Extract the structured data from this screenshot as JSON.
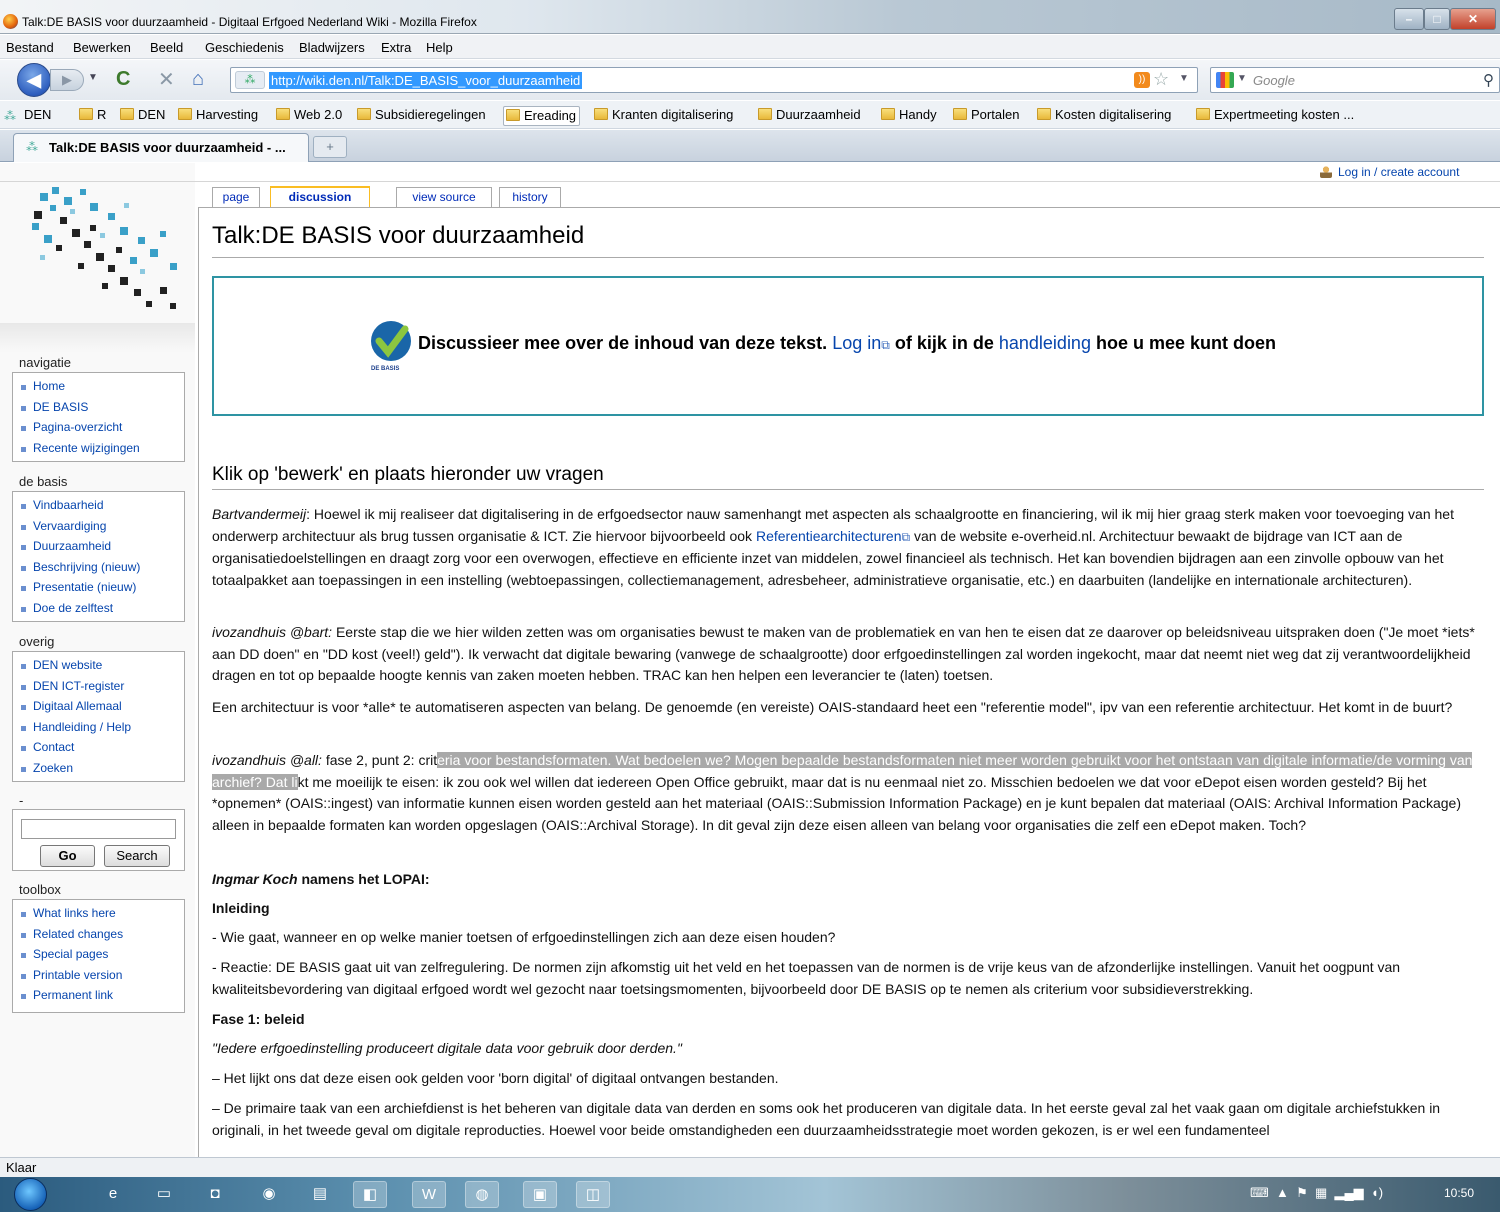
{
  "window": {
    "title": "Talk:DE BASIS voor duurzaamheid - Digitaal Erfgoed Nederland Wiki - Mozilla Firefox"
  },
  "menu": [
    "Bestand",
    "Bewerken",
    "Beeld",
    "Geschiedenis",
    "Bladwijzers",
    "Extra",
    "Help"
  ],
  "nav": {
    "url": "http://wiki.den.nl/Talk:DE_BASIS_voor_duurzaamheid",
    "search_placeholder": "Google"
  },
  "bookmarks": [
    "DEN",
    "R",
    "DEN",
    "Harvesting",
    "Web 2.0",
    "Subsidieregelingen",
    "Ereading",
    "Kranten digitalisering",
    "Duurzaamheid",
    "Handy",
    "Portalen",
    "Kosten digitalisering",
    "Expertmeeting kosten ..."
  ],
  "tab": {
    "label": "Talk:DE BASIS voor duurzaamheid - ...",
    "new_tab": "+"
  },
  "page": {
    "login": "Log in / create account",
    "tabs": [
      "page",
      "discussion",
      "view source",
      "history"
    ],
    "title": "Talk:DE BASIS voor duurzaamheid",
    "notice": {
      "text1": "Discussieer mee over de inhoud van deze tekst.",
      "link1": "Log in",
      "text2": "of kijk in de",
      "link2": "handleiding",
      "text3": "hoe u mee kunt doen",
      "logo_label": "DE BASIS"
    },
    "heading": "Klik op 'bewerk' en plaats hieronder uw vragen",
    "p1": {
      "author": "Bartvandermeij",
      "a": ": Hoewel ik mij realiseer dat digitalisering in de erfgoedsector nauw samenhangt met aspecten als schaalgrootte en financiering, wil ik mij hier graag sterk maken voor toevoeging van het onderwerp architectuur als brug tussen organisatie & ICT. Zie hiervoor bijvoorbeeld ook ",
      "link": "Referentiearchitecturen",
      "b": " van de website e-overheid.nl. Architectuur bewaakt de bijdrage van ICT aan de organisatiedoelstellingen en draagt zorg voor een overwogen, effectieve en efficiente inzet van middelen, zowel financieel als technisch. Het kan bovendien bijdragen aan een zinvolle opbouw van het totaalpakket aan toepassingen in een instelling (webtoepassingen, collectiemanagement, adresbeheer, administratieve organisatie, etc.) en daarbuiten (landelijke en internationale architecturen)."
    },
    "p2": {
      "author": "ivozandhuis @bart:",
      "text": " Eerste stap die we hier wilden zetten was om organisaties bewust te maken van de problematiek en van hen te eisen dat ze daarover op beleidsniveau uitspraken doen (\"Je moet *iets* aan DD doen\" en \"DD kost (veel!) geld\"). Ik verwacht dat digitale bewaring (vanwege de schaalgrootte) door erfgoedinstellingen zal worden ingekocht, maar dat neemt niet weg dat zij verantwoordelijkheid dragen en tot op bepaalde hoogte kennis van zaken moeten hebben. TRAC kan hen helpen een leverancier te (laten) toetsen."
    },
    "p3": "Een architectuur is voor *alle* te automatiseren aspecten van belang. De genoemde (en vereiste) OAIS-standaard heet een \"referentie model\", ipv van een referentie architectuur. Het komt in de buurt?",
    "p4": {
      "author": "ivozandhuis @all:",
      "a": " fase 2, punt 2: crit",
      "hl": "eria voor bestandsformaten. Wat bedoelen we? Mogen bepaalde bestandsformaten niet meer worden gebruikt voor het ontstaan van digitale informatie/de vorming van archief? Dat li",
      "b": "kt me moeilijk te eisen: ik zou ook wel willen dat iedereen Open Office gebruikt, maar dat is nu eenmaal niet zo. Misschien bedoelen we dat voor eDepot eisen worden gesteld? Bij het *opnemen* (OAIS::ingest) van informatie kunnen eisen worden gesteld aan het materiaal (OAIS::Submission Information Package) en je kunt bepalen dat materiaal (OAIS: Archival Information Package) alleen in bepaalde formaten kan worden opgeslagen (OAIS::Archival Storage). In dit geval zijn deze eisen alleen van belang voor organisaties die zelf een eDepot maken. Toch?"
    },
    "p5": {
      "name": "Ingmar Koch",
      "rest": " namens het LOPAI:"
    },
    "h_inleiding": "Inleiding",
    "p6": "- Wie gaat, wanneer en op welke manier toetsen of erfgoedinstellingen zich aan deze eisen houden?",
    "p7": "- Reactie: DE BASIS gaat uit van zelfregulering. De normen zijn afkomstig uit het veld en het toepassen van de normen is de vrije keus van de afzonderlijke instellingen. Vanuit het oogpunt van kwaliteitsbevordering van digitaal erfgoed wordt wel gezocht naar toetsingsmomenten, bijvoorbeeld door DE BASIS op te nemen als criterium voor subsidieverstrekking.",
    "h_fase1": "Fase 1: beleid",
    "p8": "\"Iedere erfgoedinstelling produceert digitale data voor gebruik door derden.\"",
    "p9": "– Het lijkt ons dat deze eisen ook gelden voor 'born digital' of digitaal ontvangen bestanden.",
    "p10": "– De primaire taak van een archiefdienst is het beheren van digitale data van derden en soms ook het produceren van digitale data. In het eerste geval zal het vaak gaan om digitale archiefstukken in originali, in het tweede geval om digitale reproducties. Hoewel voor beide omstandigheden een duurzaamheidsstrategie moet worden gekozen, is er wel een fundamenteel"
  },
  "sidebar": {
    "navigatie": {
      "title": "navigatie",
      "items": [
        "Home",
        "DE BASIS",
        "Pagina-overzicht",
        "Recente wijzigingen"
      ]
    },
    "debasis": {
      "title": "de basis",
      "items": [
        "Vindbaarheid",
        "Vervaardiging",
        "Duurzaamheid",
        "Beschrijving (nieuw)",
        "Presentatie (nieuw)",
        "Doe de zelftest"
      ]
    },
    "overig": {
      "title": "overig",
      "items": [
        "DEN website",
        "DEN ICT-register",
        "Digitaal Allemaal",
        "Handleiding / Help",
        "Contact",
        "Zoeken"
      ]
    },
    "search": {
      "title": "-",
      "go": "Go",
      "search": "Search"
    },
    "toolbox": {
      "title": "toolbox",
      "items": [
        "What links here",
        "Related changes",
        "Special pages",
        "Printable version",
        "Permanent link"
      ]
    }
  },
  "status": "Klaar",
  "taskbar": {
    "time": "10:50"
  }
}
